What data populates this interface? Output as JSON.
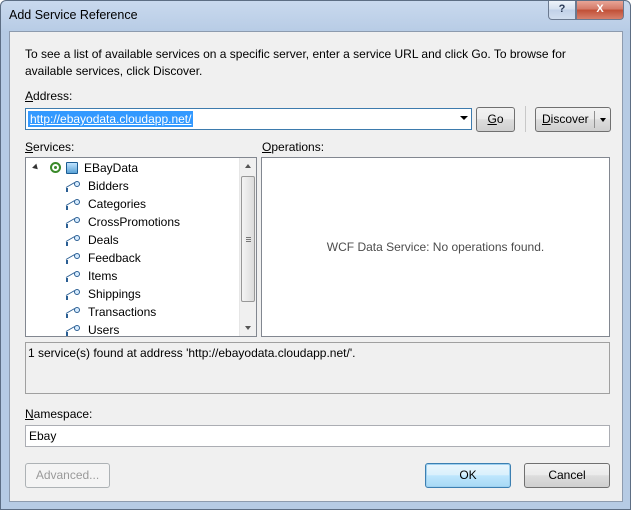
{
  "window": {
    "title": "Add Service Reference",
    "help_label": "?",
    "close_label": "X"
  },
  "instructions": "To see a list of available services on a specific server, enter a service URL and click Go. To browse for available services, click Discover.",
  "address": {
    "label_first": "A",
    "label_rest": "ddress:",
    "value": "http://ebayodata.cloudapp.net/"
  },
  "buttons": {
    "go_first": "G",
    "go_rest": "o",
    "discover_first": "D",
    "discover_rest": "iscover",
    "advanced": "Advanced...",
    "ok": "OK",
    "cancel": "Cancel"
  },
  "services": {
    "label_first": "S",
    "label_rest": "ervices:",
    "root": "EBayData",
    "items": [
      "Bidders",
      "Categories",
      "CrossPromotions",
      "Deals",
      "Feedback",
      "Items",
      "Shippings",
      "Transactions",
      "Users"
    ]
  },
  "operations": {
    "label_first": "O",
    "label_rest": "perations:",
    "empty_message": "WCF Data Service: No operations found."
  },
  "status_message": "1 service(s) found at address 'http://ebayodata.cloudapp.net/'.",
  "namespace": {
    "label_first": "N",
    "label_rest": "amespace:",
    "value": "Ebay"
  },
  "icons": {
    "service": "service-icon",
    "entity_set": "endpoint-icon",
    "expander": "expand-arrow-icon"
  }
}
